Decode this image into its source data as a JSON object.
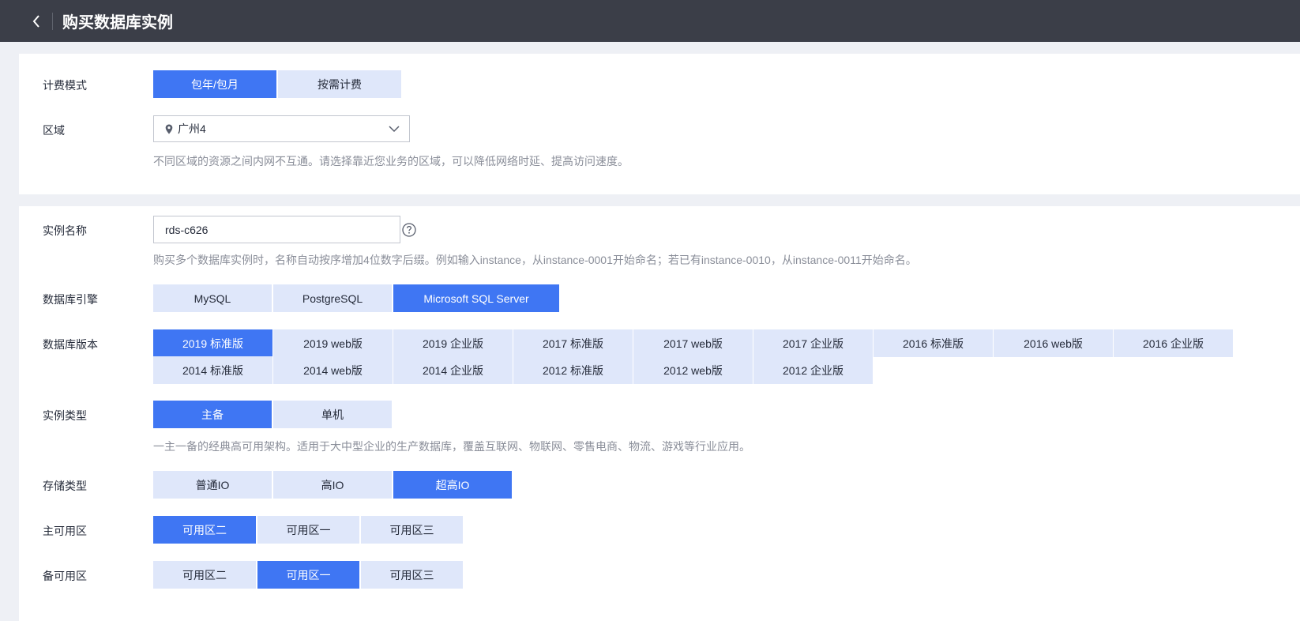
{
  "header": {
    "title": "购买数据库实例"
  },
  "billing": {
    "label": "计费模式",
    "options": [
      "包年/包月",
      "按需计费"
    ],
    "selected": "包年/包月"
  },
  "region": {
    "label": "区域",
    "value": "广州4",
    "hint": "不同区域的资源之间内网不互通。请选择靠近您业务的区域，可以降低网络时延、提高访问速度。"
  },
  "instance_name": {
    "label": "实例名称",
    "value": "rds-c626",
    "hint": "购买多个数据库实例时，名称自动按序增加4位数字后缀。例如输入instance，从instance-0001开始命名；若已有instance-0010，从instance-0011开始命名。"
  },
  "engine": {
    "label": "数据库引擎",
    "options": [
      "MySQL",
      "PostgreSQL",
      "Microsoft SQL Server"
    ],
    "selected": "Microsoft SQL Server"
  },
  "version": {
    "label": "数据库版本",
    "row1": [
      "2019 标准版",
      "2019 web版",
      "2019 企业版",
      "2017 标准版",
      "2017 web版",
      "2017 企业版",
      "2016 标准版",
      "2016 web版",
      "2016 企业版"
    ],
    "row2": [
      "2014 标准版",
      "2014 web版",
      "2014 企业版",
      "2012 标准版",
      "2012 web版",
      "2012 企业版"
    ],
    "selected": "2019 标准版"
  },
  "instance_type": {
    "label": "实例类型",
    "options": [
      "主备",
      "单机"
    ],
    "selected": "主备",
    "hint": "一主一备的经典高可用架构。适用于大中型企业的生产数据库，覆盖互联网、物联网、零售电商、物流、游戏等行业应用。"
  },
  "storage": {
    "label": "存储类型",
    "options": [
      "普通IO",
      "高IO",
      "超高IO"
    ],
    "selected": "超高IO"
  },
  "primary_az": {
    "label": "主可用区",
    "options": [
      "可用区二",
      "可用区一",
      "可用区三"
    ],
    "selected": "可用区二"
  },
  "standby_az": {
    "label": "备可用区",
    "options": [
      "可用区二",
      "可用区一",
      "可用区三"
    ],
    "selected": "可用区一"
  },
  "colors": {
    "accent": "#3f76f3",
    "option_bg": "#dfe7fa",
    "topbar": "#3b3e48"
  },
  "icons": {
    "back": "chevron-left-icon",
    "location": "location-pin-icon",
    "dropdown": "chevron-down-icon",
    "help": "question-circle-icon"
  }
}
